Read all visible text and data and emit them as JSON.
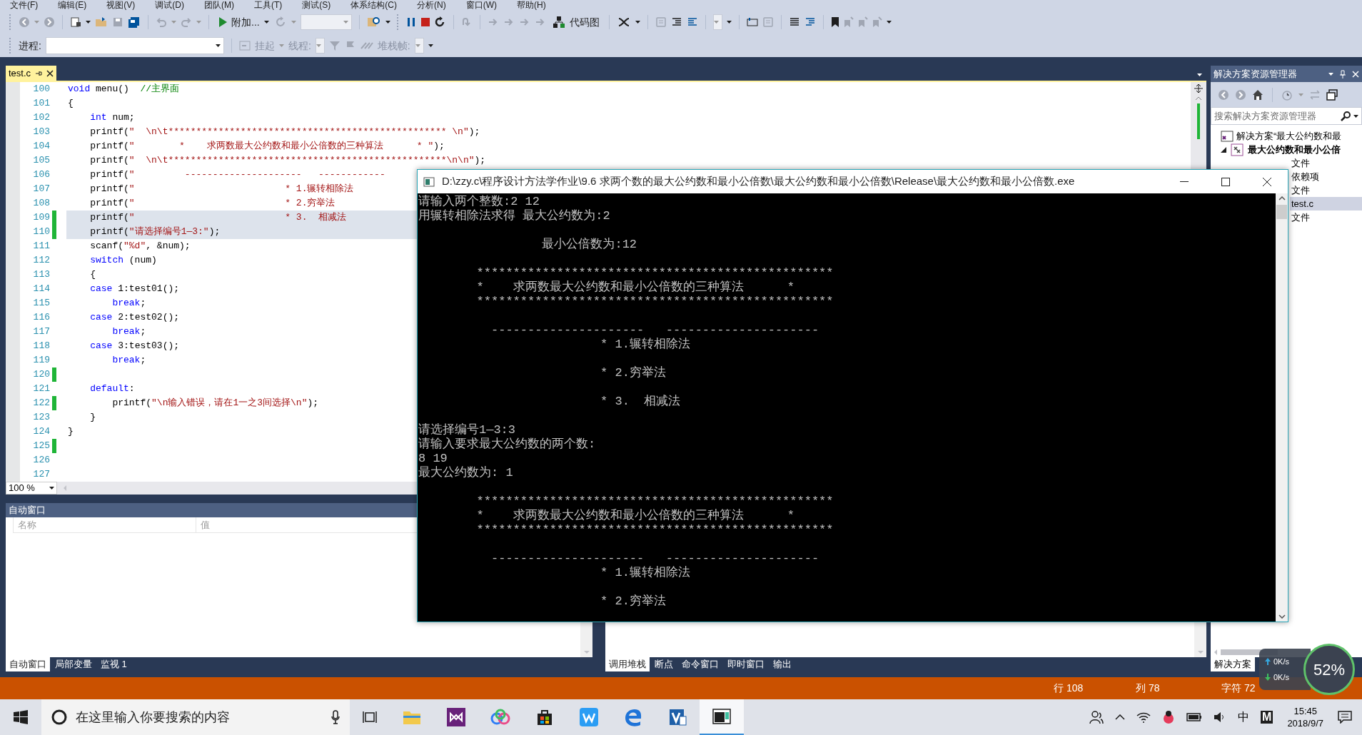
{
  "menu": [
    "文件(F)",
    "编辑(E)",
    "视图(V)",
    "调试(D)",
    "团队(M)",
    "工具(T)",
    "测试(S)",
    "体系结构(C)",
    "分析(N)",
    "窗口(W)",
    "帮助(H)"
  ],
  "toolbar": {
    "attach_label": "附加...",
    "codemap_label": "代码图"
  },
  "debug_bar": {
    "process_label": "进程:",
    "suspend_label": "挂起",
    "thread_label": "线程:",
    "stackframe_label": "堆栈帧:"
  },
  "editor": {
    "tab": {
      "title": "test.c",
      "selected": true
    },
    "zoom": "100 %",
    "lines": [
      {
        "number": "100",
        "changed": false,
        "selected": false,
        "tokens": [
          {
            "kind": "kw",
            "text": "void"
          },
          {
            "kind": "plain",
            "text": " menu()  "
          },
          {
            "kind": "cmt",
            "text": "//主界面"
          }
        ]
      },
      {
        "number": "101",
        "changed": false,
        "selected": false,
        "tokens": [
          {
            "kind": "plain",
            "text": "{"
          }
        ]
      },
      {
        "number": "102",
        "changed": false,
        "selected": false,
        "tokens": [
          {
            "kind": "kw",
            "text": "    int"
          },
          {
            "kind": "plain",
            "text": " num;"
          }
        ]
      },
      {
        "number": "103",
        "changed": false,
        "selected": false,
        "tokens": [
          {
            "kind": "plain",
            "text": "    printf("
          },
          {
            "kind": "str",
            "text": "\"  \\n\\t************************************************** \\n\""
          },
          {
            "kind": "plain",
            "text": ");"
          }
        ]
      },
      {
        "number": "104",
        "changed": false,
        "selected": false,
        "tokens": [
          {
            "kind": "plain",
            "text": "    printf("
          },
          {
            "kind": "str",
            "text": "\"        *    求两数最大公约数和最小公倍数的三种算法      * \""
          },
          {
            "kind": "plain",
            "text": ");"
          }
        ]
      },
      {
        "number": "105",
        "changed": false,
        "selected": false,
        "tokens": [
          {
            "kind": "plain",
            "text": "    printf("
          },
          {
            "kind": "str",
            "text": "\"  \\n\\t**************************************************\\n\\n\""
          },
          {
            "kind": "plain",
            "text": ");"
          }
        ]
      },
      {
        "number": "106",
        "changed": false,
        "selected": false,
        "tokens": [
          {
            "kind": "plain",
            "text": "    printf("
          },
          {
            "kind": "str",
            "text": "\"         ---------------------   ------------"
          }
        ]
      },
      {
        "number": "107",
        "changed": false,
        "selected": false,
        "tokens": [
          {
            "kind": "plain",
            "text": "    printf("
          },
          {
            "kind": "str",
            "text": "\"                           * 1.辗转相除法"
          }
        ]
      },
      {
        "number": "108",
        "changed": false,
        "selected": false,
        "tokens": [
          {
            "kind": "plain",
            "text": "    printf("
          },
          {
            "kind": "str",
            "text": "\"                           * 2.穷举法"
          }
        ]
      },
      {
        "number": "109",
        "changed": true,
        "selected": true,
        "tokens": [
          {
            "kind": "plain",
            "text": "    printf("
          },
          {
            "kind": "str",
            "text": "\"                           * 3.  相减法"
          }
        ]
      },
      {
        "number": "110",
        "changed": true,
        "selected": true,
        "tokens": [
          {
            "kind": "plain",
            "text": "    printf("
          },
          {
            "kind": "str",
            "text": "\"请选择编号1—3:\""
          },
          {
            "kind": "plain",
            "text": ");"
          }
        ]
      },
      {
        "number": "111",
        "changed": false,
        "selected": false,
        "tokens": [
          {
            "kind": "plain",
            "text": "    scanf("
          },
          {
            "kind": "str",
            "text": "\"%d\""
          },
          {
            "kind": "plain",
            "text": ", &num);"
          }
        ]
      },
      {
        "number": "112",
        "changed": false,
        "selected": false,
        "tokens": [
          {
            "kind": "kw",
            "text": "    switch"
          },
          {
            "kind": "plain",
            "text": " (num)"
          }
        ]
      },
      {
        "number": "113",
        "changed": false,
        "selected": false,
        "tokens": [
          {
            "kind": "plain",
            "text": "    {"
          }
        ]
      },
      {
        "number": "114",
        "changed": false,
        "selected": false,
        "tokens": [
          {
            "kind": "kw",
            "text": "    case"
          },
          {
            "kind": "plain",
            "text": " 1:test01();"
          }
        ]
      },
      {
        "number": "115",
        "changed": false,
        "selected": false,
        "tokens": [
          {
            "kind": "kw",
            "text": "        break"
          },
          {
            "kind": "plain",
            "text": ";"
          }
        ]
      },
      {
        "number": "116",
        "changed": false,
        "selected": false,
        "tokens": [
          {
            "kind": "kw",
            "text": "    case"
          },
          {
            "kind": "plain",
            "text": " 2:test02();"
          }
        ]
      },
      {
        "number": "117",
        "changed": false,
        "selected": false,
        "tokens": [
          {
            "kind": "kw",
            "text": "        break"
          },
          {
            "kind": "plain",
            "text": ";"
          }
        ]
      },
      {
        "number": "118",
        "changed": false,
        "selected": false,
        "tokens": [
          {
            "kind": "kw",
            "text": "    case"
          },
          {
            "kind": "plain",
            "text": " 3:test03();"
          }
        ]
      },
      {
        "number": "119",
        "changed": false,
        "selected": false,
        "tokens": [
          {
            "kind": "kw",
            "text": "        break"
          },
          {
            "kind": "plain",
            "text": ";"
          }
        ]
      },
      {
        "number": "120",
        "changed": true,
        "selected": false
      },
      {
        "number": "121",
        "changed": false,
        "selected": false,
        "tokens": [
          {
            "kind": "kw",
            "text": "    default"
          },
          {
            "kind": "plain",
            "text": ":"
          }
        ]
      },
      {
        "number": "122",
        "changed": true,
        "selected": false,
        "tokens": [
          {
            "kind": "plain",
            "text": "        printf("
          },
          {
            "kind": "str",
            "text": "\"\\n输入错误，请在1一之3间选择\\n\""
          },
          {
            "kind": "plain",
            "text": ");"
          }
        ]
      },
      {
        "number": "123",
        "changed": false,
        "selected": false,
        "tokens": [
          {
            "kind": "plain",
            "text": "    }"
          }
        ]
      },
      {
        "number": "124",
        "changed": false,
        "selected": false,
        "tokens": [
          {
            "kind": "plain",
            "text": "}"
          }
        ]
      },
      {
        "number": "125",
        "changed": true,
        "selected": false
      },
      {
        "number": "126",
        "changed": false,
        "selected": false
      },
      {
        "number": "127",
        "changed": false,
        "selected": false
      }
    ]
  },
  "auto_window": {
    "title": "自动窗口",
    "columns": [
      "名称",
      "值"
    ]
  },
  "bottom_left_tabs": [
    {
      "label": "自动窗口",
      "selected": true
    },
    {
      "label": "局部变量",
      "selected": false
    },
    {
      "label": "监视 1",
      "selected": false
    }
  ],
  "bottom_right_tabs": [
    {
      "label": "调用堆栈",
      "selected": true
    },
    {
      "label": "断点",
      "selected": false
    },
    {
      "label": "命令窗口",
      "selected": false
    },
    {
      "label": "即时窗口",
      "selected": false
    },
    {
      "label": "输出",
      "selected": false
    }
  ],
  "solution_explorer": {
    "title": "解决方案资源管理器",
    "search_placeholder": "搜索解决方案资源管理器",
    "tree": [
      {
        "label": "解决方案“最大公约数和最",
        "children": [
          {
            "label": "最大公约数和最小公倍",
            "expanded": true,
            "children": [
              {
                "label": "文件",
                "selected": false
              },
              {
                "label": "依赖项",
                "selected": false
              },
              {
                "label": "文件",
                "selected": false,
                "children": [
                  {
                    "label": "test.c",
                    "selected": true
                  }
                ]
              },
              {
                "label": "文件",
                "selected": false
              }
            ]
          }
        ]
      }
    ],
    "bottom_tab": "解决方案"
  },
  "status_bar": {
    "line": "行 108",
    "column": "列 78",
    "char": "字符 72"
  },
  "console": {
    "title": "D:\\zzy.c\\程序设计方法学作业\\9.6 求两个数的最大公约数和最小公倍数\\最大公约数和最小公倍数\\Release\\最大公约数和最小公倍数.exe",
    "blocks": [
      [
        "请输入两个整数:2 12",
        "用辗转相除法求得 最大公约数为:2"
      ],
      [
        "                 最小公倍数为:12"
      ],
      [
        "        *************************************************",
        "        *    求两数最大公约数和最小公倍数的三种算法      *",
        "        *************************************************"
      ],
      [
        "          ---------------------   ---------------------",
        "                         * 1.辗转相除法"
      ],
      [
        "                         * 2.穷举法"
      ],
      [
        "                         * 3.  相减法"
      ],
      [
        "请选择编号1—3:3",
        "请输入要求最大公约数的两个数:",
        "8 19",
        "最大公约数为: 1"
      ],
      [
        "        *************************************************",
        "        *    求两数最大公约数和最小公倍数的三种算法      *",
        "        *************************************************"
      ],
      [
        "          ---------------------   ---------------------",
        "                         * 1.辗转相除法"
      ],
      [
        "                         * 2.穷举法"
      ]
    ]
  },
  "net_widget": {
    "upload": "0K/s",
    "download": "0K/s",
    "percent": "52%"
  },
  "taskbar": {
    "search_placeholder": "在这里输入你要搜索的内容",
    "ime": "中",
    "ime_mode": "M",
    "time": "15:45",
    "date": "2018/9/7"
  }
}
